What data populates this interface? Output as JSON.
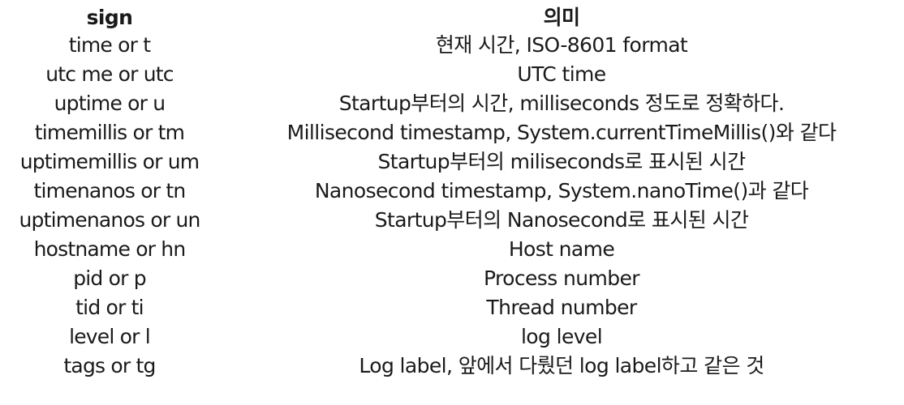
{
  "table": {
    "headers": {
      "sign": "sign",
      "meaning": "의미"
    },
    "rows": [
      {
        "sign": "time or t",
        "meaning": "현재 시간, ISO-8601 format"
      },
      {
        "sign": "utc me or utc",
        "meaning": "UTC time"
      },
      {
        "sign": "uptime or u",
        "meaning": "Startup부터의 시간, milliseconds 정도로 정확하다."
      },
      {
        "sign": "timemillis or tm",
        "meaning": "Millisecond timestamp, System.currentTimeMillis()와 같다"
      },
      {
        "sign": "uptimemillis or um",
        "meaning": "Startup부터의 miliseconds로 표시된 시간"
      },
      {
        "sign": "timenanos or tn",
        "meaning": "Nanosecond timestamp, System.nanoTime()과 같다"
      },
      {
        "sign": "uptimenanos or un",
        "meaning": "Startup부터의 Nanosecond로 표시된 시간"
      },
      {
        "sign": "hostname or hn",
        "meaning": "Host name"
      },
      {
        "sign": "pid or p",
        "meaning": "Process number"
      },
      {
        "sign": "tid or ti",
        "meaning": "Thread number"
      },
      {
        "sign": "level or l",
        "meaning": "log level"
      },
      {
        "sign": "tags or tg",
        "meaning": "Log label, 앞에서 다뤘던 log label하고 같은 것"
      }
    ]
  }
}
